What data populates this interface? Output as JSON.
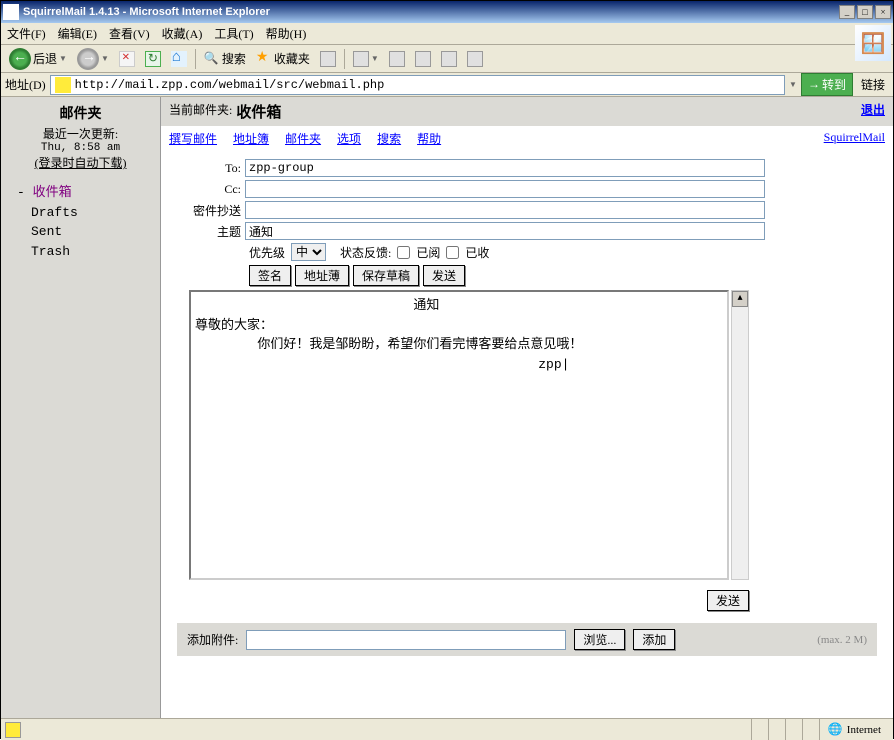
{
  "window": {
    "title": "SquirrelMail 1.4.13 - Microsoft Internet Explorer",
    "min": "_",
    "max": "□",
    "close": "×"
  },
  "menubar": {
    "file": "文件(F)",
    "edit": "编辑(E)",
    "view": "查看(V)",
    "favorites": "收藏(A)",
    "tools": "工具(T)",
    "help": "帮助(H)"
  },
  "toolbar": {
    "back": "后退",
    "search": "搜索",
    "favorites": "收藏夹"
  },
  "addressbar": {
    "label": "地址(D)",
    "url": "http://mail.zpp.com/webmail/src/webmail.php",
    "go": "转到",
    "links": "链接"
  },
  "sidebar": {
    "title": "邮件夹",
    "update_label": "最近一次更新:",
    "update_time": "Thu, 8:58 am",
    "auto_download": "(登录时自动下载)",
    "inbox_prefix": "- ",
    "inbox": "收件箱",
    "drafts": "Drafts",
    "sent": "Sent",
    "trash": "Trash"
  },
  "header": {
    "current_label": "当前邮件夹:",
    "current_folder": "收件箱",
    "logout": "退出"
  },
  "nav": {
    "compose": "撰写邮件",
    "addresses": "地址簿",
    "folders": "邮件夹",
    "options": "选项",
    "search": "搜索",
    "help": "帮助",
    "brand": "SquirrelMail"
  },
  "compose": {
    "to_label": "To:",
    "to_value": "zpp-group",
    "cc_label": "Cc:",
    "cc_value": "",
    "bcc_label": "密件抄送",
    "bcc_value": "",
    "subject_label": "主题",
    "subject_value": "通知",
    "priority_label": "优先级",
    "priority_value": "中",
    "receipt_label": "状态反馈:",
    "read_label": "已阅",
    "delivery_label": "已收",
    "sign_btn": "签名",
    "addr_btn": "地址薄",
    "draft_btn": "保存草稿",
    "send_btn": "发送",
    "body": "                            通知\n尊敬的大家：\n        你们好！我是邹盼盼，希望你们看完博客要给点意见哦！\n                                            zpp|",
    "send_bottom": "发送"
  },
  "attach": {
    "label": "添加附件:",
    "browse": "浏览...",
    "add": "添加",
    "max": "(max. 2 M)"
  },
  "statusbar": {
    "zone": "Internet"
  }
}
